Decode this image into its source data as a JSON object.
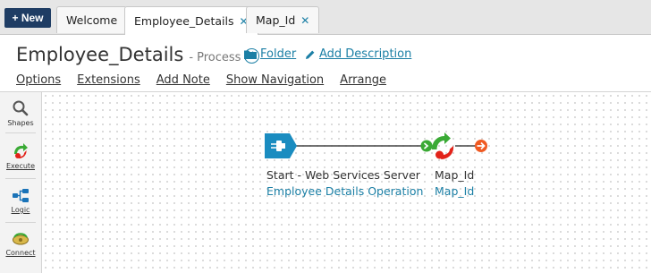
{
  "new_button": "+ New",
  "tabs": [
    {
      "label": "Welcome",
      "closable": false
    },
    {
      "label": "Employee_Details",
      "closable": true
    },
    {
      "label": "Map_Id",
      "closable": true
    }
  ],
  "close_glyph": "✕",
  "header": {
    "title": "Employee_Details",
    "subtitle": "- Process",
    "info_glyph": "i",
    "folder_link": "Folder",
    "add_description_link": "Add Description"
  },
  "menu": [
    "Options",
    "Extensions",
    "Add Note",
    "Show Navigation",
    "Arrange"
  ],
  "palette": [
    {
      "label": "Shapes",
      "icon": "search-icon"
    },
    {
      "label": "Execute",
      "icon": "execute-icon"
    },
    {
      "label": "Logic",
      "icon": "logic-icon"
    },
    {
      "label": "Connect",
      "icon": "connect-icon"
    }
  ],
  "nodes": {
    "start": {
      "name": "Start - Web Services Server",
      "sub": "Employee Details Operation",
      "icon": "web-services-start-icon"
    },
    "map": {
      "name": "Map_Id",
      "sub": "Map_Id",
      "icon": "map-icon"
    },
    "end": {
      "icon": "stop-icon"
    }
  },
  "colors": {
    "accent": "#1b7fa5",
    "new_button": "#1f3d64",
    "start_shape": "#1a8cc0",
    "connector_green": "#3aaa35",
    "stop_orange": "#f05a22"
  }
}
